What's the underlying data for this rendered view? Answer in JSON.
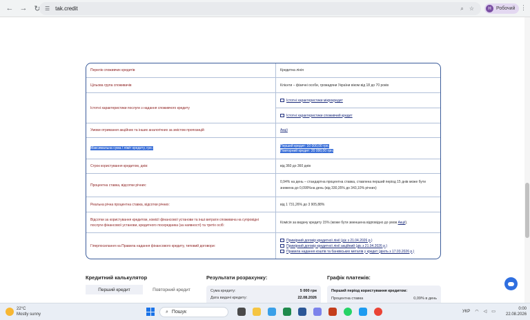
{
  "browser": {
    "url": "tak.credit",
    "profile_initial": "Н",
    "profile_name": "Робочий"
  },
  "info_table": {
    "rows": [
      {
        "label": "Перелік споживчих кредитів",
        "value": "Кредитна лінія"
      },
      {
        "label": "Цільова група споживачів",
        "value": "Клієнти – фізичні особи, громадяни України віком від 18 до 70 років"
      },
      {
        "label": "Істотні характеристики послуги з надання споживчого кредиту",
        "links": [
          "Істотні характеристики мікрокредит",
          "Істотні характеристики споживчий кредит"
        ]
      },
      {
        "label": "Умови отримання акційних та інших аналогічних за змістом пропозицій",
        "link": "Акції"
      },
      {
        "label": "Максимальна сума / ліміт кредиту, грн.:",
        "lines": [
          "Перший кредит: 10 000,00 грн.",
          "Повторний кредит: 20 000,00 грн."
        ]
      },
      {
        "label": "Строк користування кредитом, днів:",
        "value": "від 360 до 360 днів"
      },
      {
        "label": "Процентна ставка, відсотки річних:",
        "lines": [
          "0,94% на день – стандартна процентна ставка, ставлена перший період 15 днів може бути",
          "знижена до 0,099%на день (від 330,35% до 343,10% річних)"
        ]
      },
      {
        "label": "Реальна річна процентна ставка, відсотки річних:",
        "value": "від 1 731,26% до 3 905,88%"
      },
      {
        "label": "Відсотки за користування кредитом, комісії фінансової установи та інші витрати споживача на супровідні послуги фінансової установи, кредитного посередника (за наявності) та третіх осіб:",
        "value_prefix": "Комісія за видачу кредиту 15% (може бути зменшена відповідно до умов ",
        "value_link": "Акції",
        "value_suffix": ")."
      },
      {
        "label": "Гіперпосилання на Правила надання фінансового кредиту, типовий договори:",
        "links": [
          "Примірний договір кредитної лінії (діє з 21.04.2026 р.)",
          "Примірний договір кредитної лінії акційний (діє з 21.04.2026 р.)",
          "Правила надання коштів та банківських металів у кредит (діють з 17.03.2026 р.)"
        ]
      }
    ]
  },
  "calculator": {
    "title": "Кредитний калькулятор",
    "tabs": [
      "Перший кредит",
      "Повторний кредит"
    ]
  },
  "results": {
    "title": "Результати розрахунку:",
    "lines": [
      {
        "label": "Сума кредиту:",
        "value": "5 000 грн"
      },
      {
        "label": "Дата видачі кредиту:",
        "value": "22.08.2026"
      }
    ]
  },
  "schedule": {
    "title": "Графік платежів:",
    "subtitle": "Перший період користування кредитом:",
    "row_label": "Процентна ставка",
    "row_value": "0,09% в день"
  },
  "taskbar": {
    "temperature": "22°C",
    "weather": "Mostly sunny",
    "search": "Пошук",
    "lang": "УКР",
    "time": "0:00",
    "date": "22.08.2026"
  }
}
